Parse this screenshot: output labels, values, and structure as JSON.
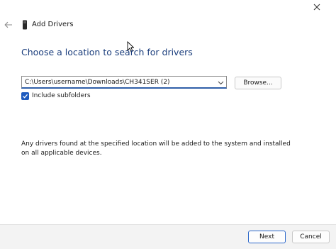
{
  "window": {
    "title": "Add Drivers",
    "close_icon": "close-icon",
    "back_icon": "back-arrow-icon",
    "device_icon": "device-icon"
  },
  "page": {
    "heading": "Choose a location to search for drivers",
    "path_value": "C:\\Users\\username\\Downloads\\CH341SER (2)",
    "browse_label": "Browse...",
    "include_subfolders_label": "Include subfolders",
    "include_subfolders_checked": true,
    "info_text": "Any drivers found at the specified location will be added to the system and installed on all applicable devices."
  },
  "footer": {
    "next_label": "Next",
    "cancel_label": "Cancel"
  },
  "colors": {
    "heading": "#1a3d7c",
    "accent": "#1e5bbf",
    "footer_bg": "#f3f3f3"
  }
}
